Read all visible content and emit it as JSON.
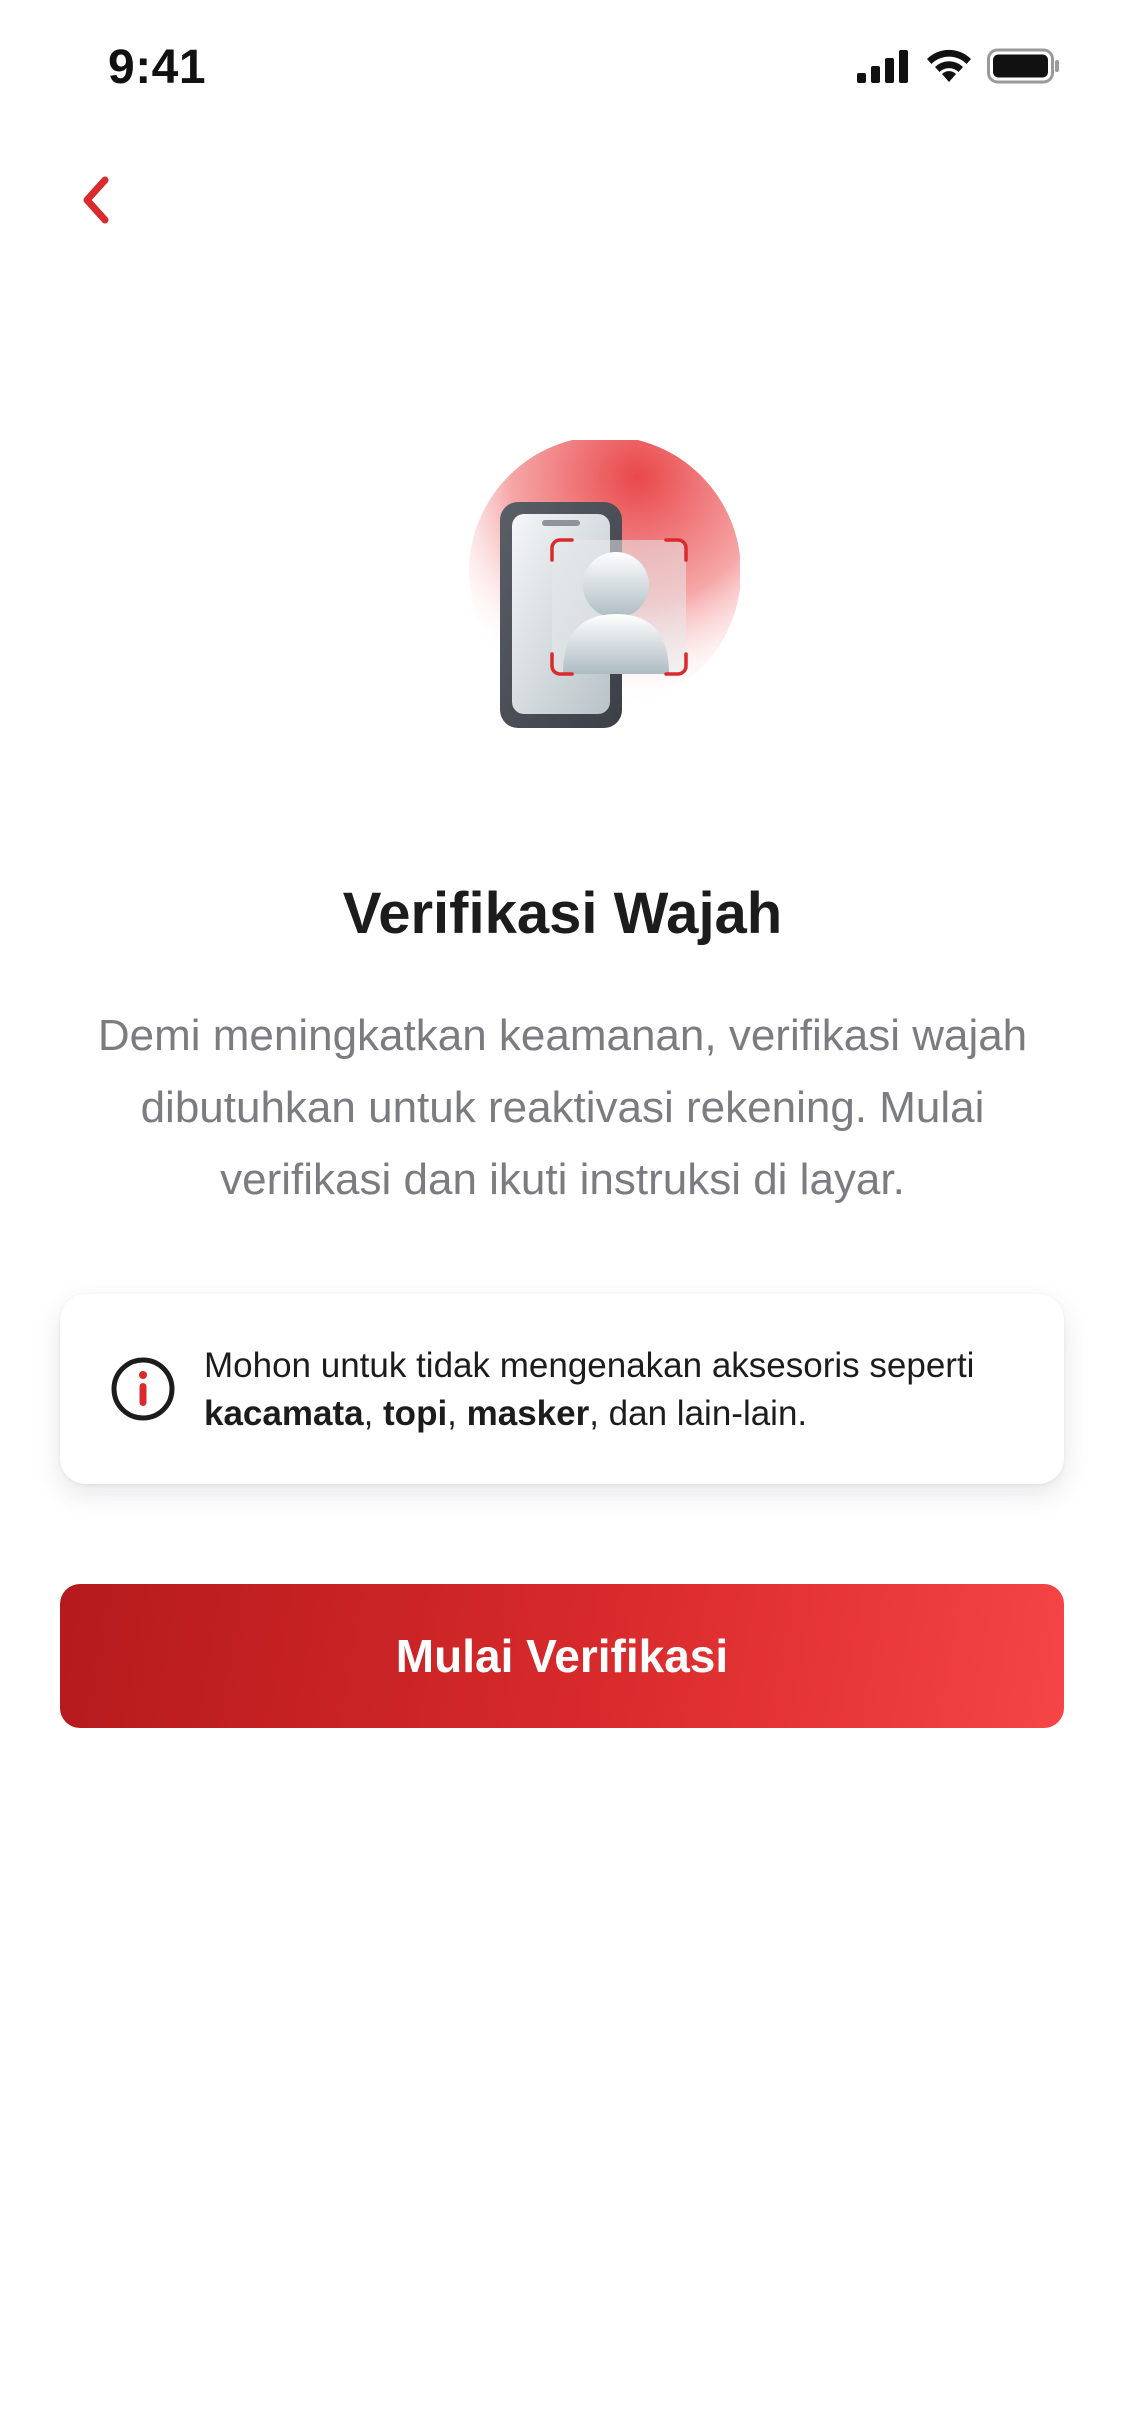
{
  "status_bar": {
    "time": "9:41",
    "icons": [
      "signal-icon",
      "wifi-icon",
      "battery-icon"
    ]
  },
  "nav": {
    "back_icon": "chevron-left-icon"
  },
  "illustration": {
    "icon": "phone-face-scan-icon"
  },
  "title": "Verifikasi Wajah",
  "description": "Demi meningkatkan keamanan, verifikasi wajah dibutuhkan untuk reaktivasi rekening. Mulai verifikasi dan ikuti instruksi di layar.",
  "notice": {
    "icon": "info-icon",
    "text_prefix": "Mohon untuk tidak mengenakan aksesoris seperti ",
    "item_1": "kacamata",
    "sep_1": ", ",
    "item_2": "topi",
    "sep_2": ", ",
    "item_3": "masker",
    "text_suffix": ", dan lain-lain."
  },
  "primary_button": {
    "label": "Mulai Verifikasi"
  },
  "colors": {
    "accent": "#d92a2c",
    "accent_dark": "#b51a1c",
    "accent_light": "#f54546",
    "text_primary": "#1c1c1c",
    "text_secondary": "#7b7b82"
  }
}
